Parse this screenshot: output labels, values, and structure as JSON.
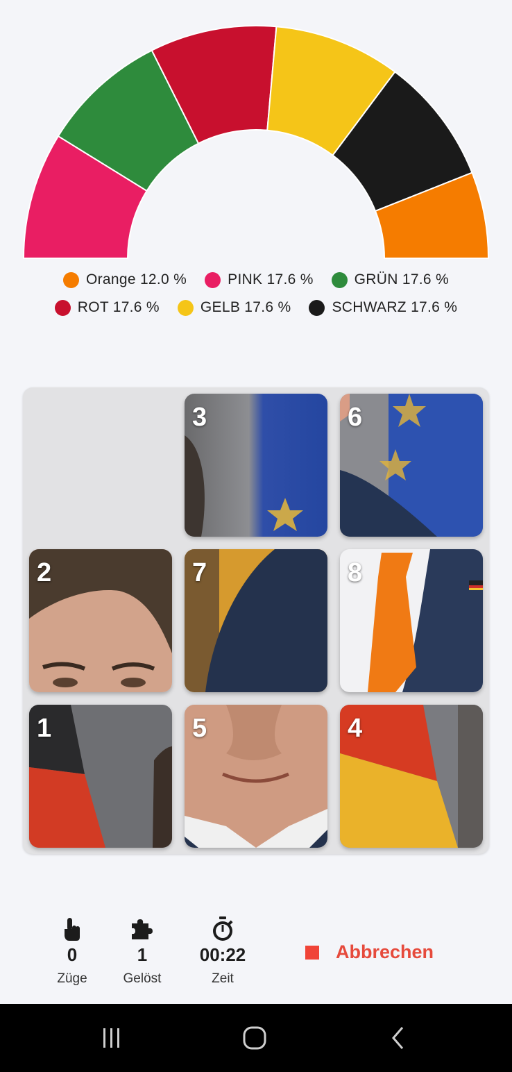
{
  "chart_data": {
    "type": "pie",
    "variant": "half-donut",
    "slices": [
      {
        "name": "PINK",
        "value": 17.6,
        "color": "#e91e63"
      },
      {
        "name": "GRÜN",
        "value": 17.6,
        "color": "#2e8b3c"
      },
      {
        "name": "ROT",
        "value": 17.6,
        "color": "#c8102e"
      },
      {
        "name": "GELB",
        "value": 17.6,
        "color": "#f5c518"
      },
      {
        "name": "SCHWARZ",
        "value": 17.6,
        "color": "#1a1a1a"
      },
      {
        "name": "Orange",
        "value": 12.0,
        "color": "#f57c00"
      }
    ],
    "legend_rows": [
      [
        {
          "label": "Orange 12.0 %",
          "color": "#f57c00"
        },
        {
          "label": "PINK 17.6 %",
          "color": "#e91e63"
        },
        {
          "label": "GRÜN 17.6 %",
          "color": "#2e8b3c"
        }
      ],
      [
        {
          "label": "ROT 17.6 %",
          "color": "#c8102e"
        },
        {
          "label": "GELB 17.6 %",
          "color": "#f5c518"
        },
        {
          "label": "SCHWARZ 17.6 %",
          "color": "#1a1a1a"
        }
      ]
    ]
  },
  "puzzle": {
    "tiles": [
      {
        "number": "3",
        "slot": 1
      },
      {
        "number": "6",
        "slot": 2
      },
      {
        "number": "2",
        "slot": 3
      },
      {
        "number": "7",
        "slot": 4
      },
      {
        "number": "8",
        "slot": 5
      },
      {
        "number": "1",
        "slot": 6
      },
      {
        "number": "5",
        "slot": 7
      },
      {
        "number": "4",
        "slot": 8
      }
    ],
    "empty_slot": 0
  },
  "stats": {
    "moves": {
      "value": "0",
      "label": "Züge",
      "icon": "hand-pointer-icon"
    },
    "solved": {
      "value": "1",
      "label": "Gelöst",
      "icon": "puzzle-icon"
    },
    "time": {
      "value": "00:22",
      "label": "Zeit",
      "icon": "stopwatch-icon"
    }
  },
  "cancel_label": "Abbrechen",
  "colors": {
    "accent_red": "#e64a3c",
    "background": "#f4f5f9",
    "board": "#e2e2e4"
  }
}
